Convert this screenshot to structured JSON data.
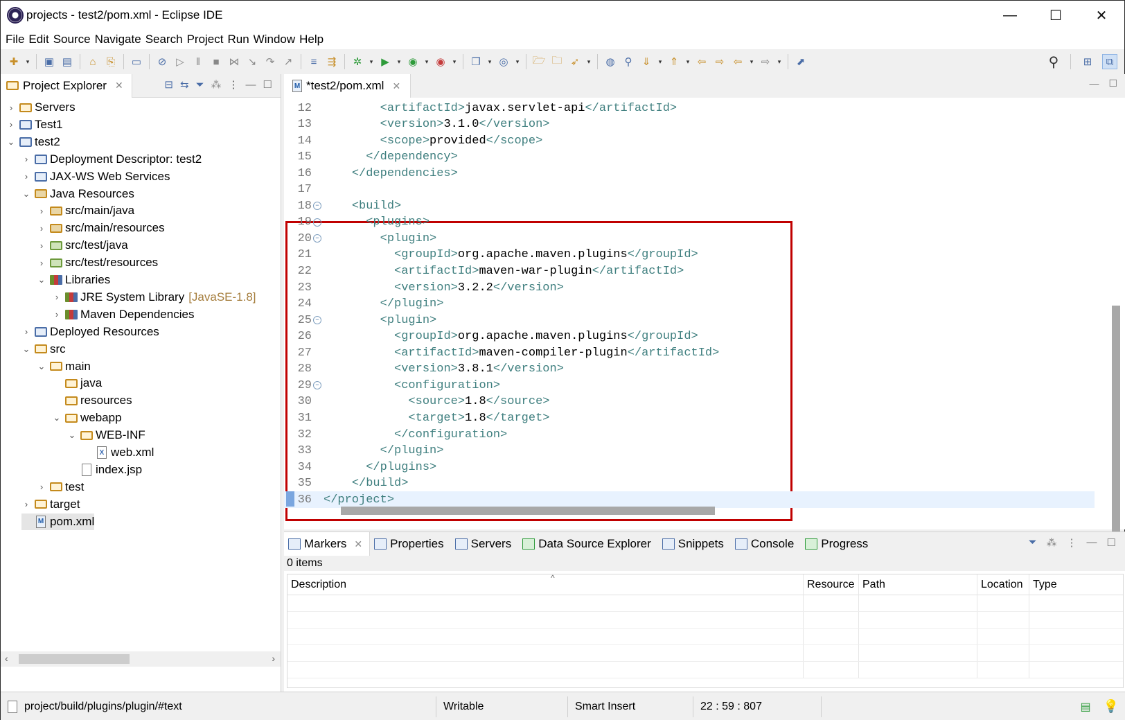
{
  "window": {
    "title": "projects - test2/pom.xml - Eclipse IDE",
    "controls": {
      "minimize": "—",
      "maximize": "☐",
      "close": "✕"
    }
  },
  "menubar": [
    "File",
    "Edit",
    "Source",
    "Navigate",
    "Search",
    "Project",
    "Run",
    "Window",
    "Help"
  ],
  "project_explorer": {
    "tab_label": "Project Explorer",
    "tree": [
      {
        "label": "Servers",
        "level": 0,
        "expanded": false,
        "icon": "folder-icon"
      },
      {
        "label": "Test1",
        "level": 0,
        "expanded": false,
        "icon": "project-icon"
      },
      {
        "label": "test2",
        "level": 0,
        "expanded": true,
        "icon": "project-icon"
      },
      {
        "label": "Deployment Descriptor: test2",
        "level": 1,
        "expanded": false,
        "icon": "descriptor-icon"
      },
      {
        "label": "JAX-WS Web Services",
        "level": 1,
        "expanded": false,
        "icon": "webservice-icon"
      },
      {
        "label": "Java Resources",
        "level": 1,
        "expanded": true,
        "icon": "java-resources-icon"
      },
      {
        "label": "src/main/java",
        "level": 2,
        "expanded": false,
        "icon": "package-folder-icon"
      },
      {
        "label": "src/main/resources",
        "level": 2,
        "expanded": false,
        "icon": "package-folder-icon"
      },
      {
        "label": "src/test/java",
        "level": 2,
        "expanded": false,
        "icon": "test-folder-icon"
      },
      {
        "label": "src/test/resources",
        "level": 2,
        "expanded": false,
        "icon": "test-folder-icon"
      },
      {
        "label": "Libraries",
        "level": 2,
        "expanded": true,
        "icon": "library-icon"
      },
      {
        "label": "JRE System Library",
        "decoration": "[JavaSE-1.8]",
        "level": 3,
        "expanded": false,
        "icon": "library-icon"
      },
      {
        "label": "Maven Dependencies",
        "level": 3,
        "expanded": false,
        "icon": "library-icon"
      },
      {
        "label": "Deployed Resources",
        "level": 1,
        "expanded": false,
        "icon": "deployed-icon"
      },
      {
        "label": "src",
        "level": 1,
        "expanded": true,
        "icon": "folder-icon"
      },
      {
        "label": "main",
        "level": 2,
        "expanded": true,
        "icon": "folder-icon"
      },
      {
        "label": "java",
        "level": 3,
        "expanded": null,
        "icon": "folder-icon"
      },
      {
        "label": "resources",
        "level": 3,
        "expanded": null,
        "icon": "folder-icon"
      },
      {
        "label": "webapp",
        "level": 3,
        "expanded": true,
        "icon": "folder-icon"
      },
      {
        "label": "WEB-INF",
        "level": 4,
        "expanded": true,
        "icon": "folder-icon"
      },
      {
        "label": "web.xml",
        "level": 5,
        "expanded": null,
        "icon": "xml-file-icon"
      },
      {
        "label": "index.jsp",
        "level": 4,
        "expanded": null,
        "icon": "jsp-file-icon"
      },
      {
        "label": "test",
        "level": 2,
        "expanded": false,
        "icon": "folder-icon"
      },
      {
        "label": "target",
        "level": 1,
        "expanded": false,
        "icon": "folder-icon"
      },
      {
        "label": "pom.xml",
        "level": 1,
        "expanded": null,
        "icon": "maven-file-icon",
        "selected": true
      }
    ]
  },
  "editor": {
    "tab_label": "*test2/pom.xml",
    "lines": [
      {
        "num": "12",
        "indent": "        ",
        "open": "<artifactId>",
        "text": "javax.servlet-api",
        "close": "</artifactId>",
        "fold": false
      },
      {
        "num": "13",
        "indent": "        ",
        "open": "<version>",
        "text": "3.1.0",
        "close": "</version>",
        "fold": false
      },
      {
        "num": "14",
        "indent": "        ",
        "open": "<scope>",
        "text": "provided",
        "close": "</scope>",
        "fold": false
      },
      {
        "num": "15",
        "indent": "      ",
        "open": "</dependency>",
        "text": "",
        "close": "",
        "fold": false
      },
      {
        "num": "16",
        "indent": "    ",
        "open": "</dependencies>",
        "text": "",
        "close": "",
        "fold": false
      },
      {
        "num": "17",
        "indent": "",
        "open": "",
        "text": "",
        "close": "",
        "fold": false
      },
      {
        "num": "18",
        "indent": "    ",
        "open": "<build>",
        "text": "",
        "close": "",
        "fold": true
      },
      {
        "num": "19",
        "indent": "      ",
        "open": "<plugins>",
        "text": "",
        "close": "",
        "fold": true
      },
      {
        "num": "20",
        "indent": "        ",
        "open": "<plugin>",
        "text": "",
        "close": "",
        "fold": true
      },
      {
        "num": "21",
        "indent": "          ",
        "open": "<groupId>",
        "text": "org.apache.maven.plugins",
        "close": "</groupId>",
        "fold": false
      },
      {
        "num": "22",
        "indent": "          ",
        "open": "<artifactId>",
        "text": "maven-war-plugin",
        "close": "</artifactId>",
        "fold": false
      },
      {
        "num": "23",
        "indent": "          ",
        "open": "<version>",
        "text": "3.2.2",
        "close": "</version>",
        "fold": false
      },
      {
        "num": "24",
        "indent": "        ",
        "open": "</plugin>",
        "text": "",
        "close": "",
        "fold": false
      },
      {
        "num": "25",
        "indent": "        ",
        "open": "<plugin>",
        "text": "",
        "close": "",
        "fold": true
      },
      {
        "num": "26",
        "indent": "          ",
        "open": "<groupId>",
        "text": "org.apache.maven.plugins",
        "close": "</groupId>",
        "fold": false
      },
      {
        "num": "27",
        "indent": "          ",
        "open": "<artifactId>",
        "text": "maven-compiler-plugin",
        "close": "</artifactId>",
        "fold": false
      },
      {
        "num": "28",
        "indent": "          ",
        "open": "<version>",
        "text": "3.8.1",
        "close": "</version>",
        "fold": false
      },
      {
        "num": "29",
        "indent": "          ",
        "open": "<configuration>",
        "text": "",
        "close": "",
        "fold": true
      },
      {
        "num": "30",
        "indent": "            ",
        "open": "<source>",
        "text": "1.8",
        "close": "</source>",
        "fold": false
      },
      {
        "num": "31",
        "indent": "            ",
        "open": "<target>",
        "text": "1.8",
        "close": "</target>",
        "fold": false
      },
      {
        "num": "32",
        "indent": "          ",
        "open": "</configuration>",
        "text": "",
        "close": "",
        "fold": false
      },
      {
        "num": "33",
        "indent": "        ",
        "open": "</plugin>",
        "text": "",
        "close": "",
        "fold": false
      },
      {
        "num": "34",
        "indent": "      ",
        "open": "</plugins>",
        "text": "",
        "close": "",
        "fold": false
      },
      {
        "num": "35",
        "indent": "    ",
        "open": "</build>",
        "text": "",
        "close": "",
        "fold": false
      },
      {
        "num": "36",
        "indent": "",
        "open": "</project>",
        "text": "",
        "close": "",
        "fold": false,
        "current": true
      }
    ],
    "highlight_color": "#c00000",
    "tag_color": "#3f7f7f"
  },
  "bottom_panel": {
    "tabs": [
      {
        "label": "Markers",
        "active": true,
        "icon": "markers-icon"
      },
      {
        "label": "Properties",
        "active": false,
        "icon": "properties-icon"
      },
      {
        "label": "Servers",
        "active": false,
        "icon": "servers-icon"
      },
      {
        "label": "Data Source Explorer",
        "active": false,
        "icon": "datasource-icon"
      },
      {
        "label": "Snippets",
        "active": false,
        "icon": "snippets-icon"
      },
      {
        "label": "Console",
        "active": false,
        "icon": "console-icon"
      },
      {
        "label": "Progress",
        "active": false,
        "icon": "progress-icon"
      }
    ],
    "items_count": "0 items",
    "columns": [
      "Description",
      "Resource",
      "Path",
      "Location",
      "Type"
    ]
  },
  "statusbar": {
    "path": "project/build/plugins/plugin/#text",
    "mode": "Writable",
    "insert": "Smart Insert",
    "position": "22 : 59 : 807"
  }
}
